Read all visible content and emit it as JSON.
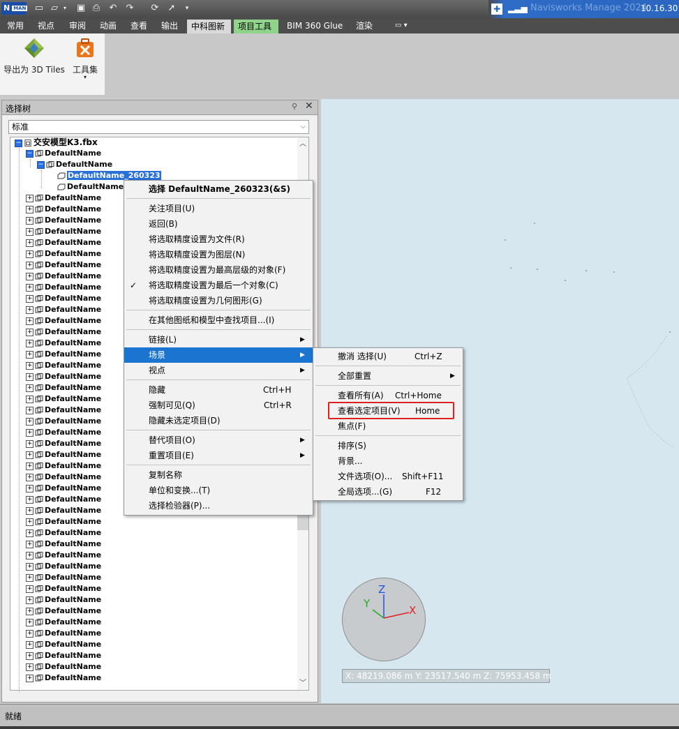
{
  "titlebar": {
    "app_icon": "N",
    "app_icon_badge": "MAN",
    "app_title": "Navisworks Manage 2024",
    "time": "10.16.30"
  },
  "menu_tabs": [
    "常用",
    "视点",
    "审阅",
    "动画",
    "查看",
    "输出",
    "中科图新",
    "项目工具",
    "BIM 360 Glue",
    "渲染"
  ],
  "ribbon": {
    "export_3dtiles_label": "导出为 3D Tiles",
    "toolkit_label": "工具集"
  },
  "selection_tree": {
    "title": "选择树",
    "mode": "标准",
    "root_label": "交安模型K3.fbx",
    "level1_label": "DefaultName",
    "level2_label": "DefaultName",
    "selected_label": "DefaultName_260323",
    "sibling_label": "DefaultName_",
    "row_label": "DefaultName"
  },
  "context_menu": {
    "items": [
      {
        "label": "选择 DefaultName_260323(&S)",
        "bold": true
      },
      {
        "label": "关注项目(U)"
      },
      {
        "label": "返回(B)"
      },
      {
        "label": "将选取精度设置为文件(R)"
      },
      {
        "label": "将选取精度设置为图层(N)"
      },
      {
        "label": "将选取精度设置为最高层级的对象(F)"
      },
      {
        "label": "将选取精度设置为最后一个对象(C)",
        "checked": true
      },
      {
        "label": "将选取精度设置为几何图形(G)"
      },
      {
        "label": "在其他图纸和模型中查找项目...(I)"
      },
      {
        "label": "链接(L)",
        "submenu": true
      },
      {
        "label": "场景",
        "submenu": true,
        "highlighted": true
      },
      {
        "label": "视点",
        "submenu": true
      },
      {
        "label": "隐藏",
        "shortcut": "Ctrl+H"
      },
      {
        "label": "强制可见(Q)",
        "shortcut": "Ctrl+R"
      },
      {
        "label": "隐藏未选定项目(D)"
      },
      {
        "label": "替代项目(O)",
        "submenu": true
      },
      {
        "label": "重置项目(E)",
        "submenu": true
      },
      {
        "label": "复制名称"
      },
      {
        "label": "单位和变换...(T)"
      },
      {
        "label": "选择检验器(P)..."
      }
    ]
  },
  "scene_submenu": {
    "items": [
      {
        "label": "撤消 选择(U)",
        "shortcut": "Ctrl+Z"
      },
      {
        "label": "全部重置",
        "submenu": true
      },
      {
        "label": "查看所有(A)",
        "shortcut": "Ctrl+Home"
      },
      {
        "label": "查看选定项目(V)",
        "shortcut": "Home",
        "boxed": true
      },
      {
        "label": "焦点(F)"
      },
      {
        "label": "排序(S)"
      },
      {
        "label": "背景..."
      },
      {
        "label": "文件选项(O)...",
        "shortcut": "Shift+F11"
      },
      {
        "label": "全局选项...(G)",
        "shortcut": "F12"
      }
    ]
  },
  "viewport": {
    "axis_x": "X",
    "axis_y": "Y",
    "axis_z": "Z",
    "coords": "X: 48219.086 m  Y: 23517.540 m  Z: 75953.458 m"
  },
  "status": {
    "text": "就绪"
  },
  "colors": {
    "selection": "#2870d8",
    "menu_highlight": "#1b75d0",
    "callout_box": "#e02020",
    "viewport_bg": "#d6e7f0"
  }
}
